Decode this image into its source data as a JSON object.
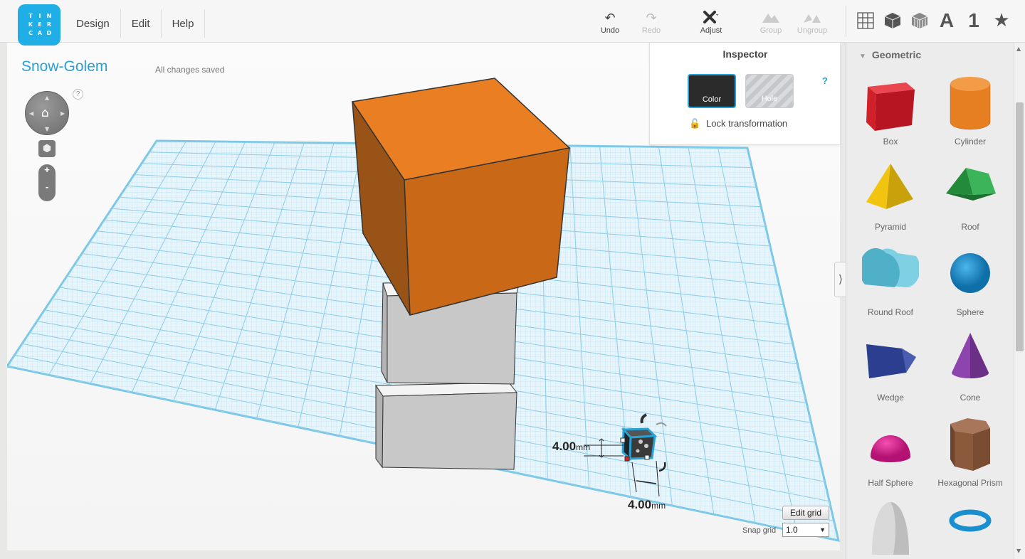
{
  "logo": {
    "letters": [
      "T",
      "I",
      "N",
      "K",
      "E",
      "R",
      "C",
      "A",
      "D"
    ]
  },
  "menu": {
    "items": [
      "Design",
      "Edit",
      "Help"
    ]
  },
  "toolbar": {
    "undo": "Undo",
    "redo": "Redo",
    "adjust": "Adjust",
    "group": "Group",
    "ungroup": "Ungroup",
    "panels": {
      "letters": "A",
      "numbers": "1"
    }
  },
  "project": {
    "title": "Snow-Golem",
    "save_status": "All changes saved"
  },
  "viewcontrols": {
    "help": "?",
    "zoom_in": "+",
    "zoom_out": "-"
  },
  "inspector": {
    "title": "Inspector",
    "help": "?",
    "color_label": "Color",
    "hole_label": "Hole",
    "lock_label": "Lock transformation",
    "color_value": "#2b2b2b"
  },
  "dimensions": {
    "value_a": "4.00",
    "value_b": "4.00",
    "unit": "mm"
  },
  "grid": {
    "edit_label": "Edit grid",
    "snap_label": "Snap grid",
    "snap_value": "1.0"
  },
  "shapes_panel": {
    "category": "Geometric",
    "items": [
      {
        "label": "Box",
        "color": "#d0202a"
      },
      {
        "label": "Cylinder",
        "color": "#e67e22"
      },
      {
        "label": "Pyramid",
        "color": "#f1c40f"
      },
      {
        "label": "Roof",
        "color": "#2ea043"
      },
      {
        "label": "Round Roof",
        "color": "#5bc0d6"
      },
      {
        "label": "Sphere",
        "color": "#1a8fd0"
      },
      {
        "label": "Wedge",
        "color": "#2c3e8f"
      },
      {
        "label": "Cone",
        "color": "#8e44ad"
      },
      {
        "label": "Half Sphere",
        "color": "#e0218a"
      },
      {
        "label": "Hexagonal Prism",
        "color": "#8b5a3c"
      },
      {
        "label": "",
        "color": "#d9d9d9"
      },
      {
        "label": "",
        "color": "#1a8fd0"
      }
    ]
  }
}
